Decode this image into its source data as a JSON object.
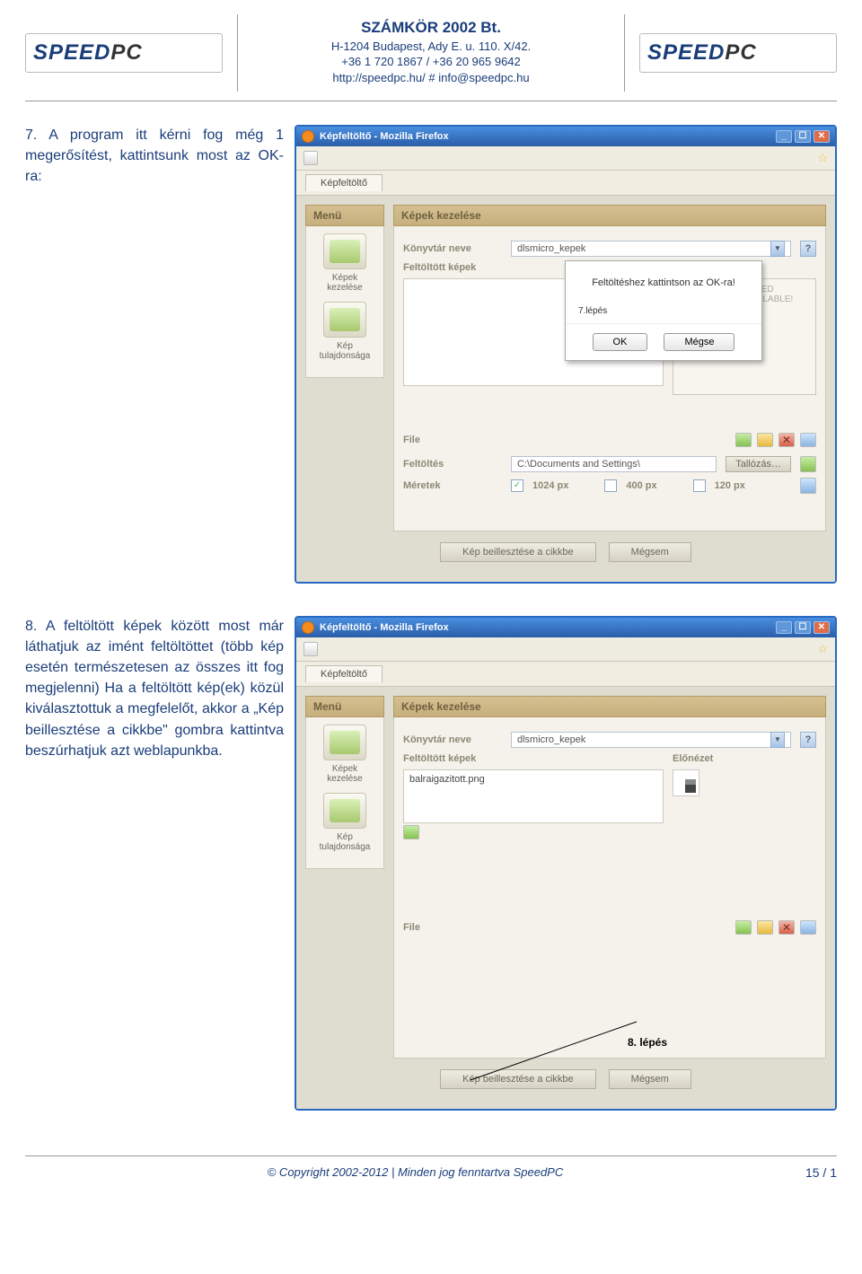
{
  "header": {
    "logo_main": "SPEED",
    "logo_accent": "PC",
    "company": "SZÁMKÖR 2002 Bt.",
    "addr": "H-1204 Budapest, Ady E. u. 110. X/42.",
    "tel": "+36 1 720 1867 / +36 20 965 9642",
    "web": "http://speedpc.hu/ # info@speedpc.hu"
  },
  "step7": {
    "text": "7.   A program itt kérni fog még 1 megerősítést, kattintsunk most az OK-ra:"
  },
  "step8": {
    "text": "8.   A feltöltött képek között most már láthatjuk az imént feltöltöttet (több kép esetén természetesen az összes itt fog megjelenni) Ha a feltöltött kép(ek) közül kiválasztottuk a megfelelőt, akkor a „Kép beillesztése a cikkbe\" gombra kattintva beszúrhatjuk azt weblapunkba."
  },
  "win": {
    "title": "Képfeltöltő - Mozilla Firefox",
    "tab": "Képfeltöltő",
    "side_hdr": "Menü",
    "side_item1": "Képek kezelése",
    "side_item2": "Kép tulajdonsága",
    "main_hdr": "Képek kezelése",
    "lbl_dir": "Könyvtár neve",
    "lbl_uploaded": "Feltöltött képek",
    "lbl_preview": "Előnézet",
    "dir_value": "dlsmicro_kepek",
    "noimg": "NO IMAGE SELECTED PREVIEW NOT AVAILABLE!",
    "lbl_file": "File",
    "lbl_upload": "Feltöltés",
    "lbl_sizes": "Méretek",
    "path": "C:\\Documents and Settings\\",
    "browse": "Tallózás…",
    "s1": "1024 px",
    "s2": "400 px",
    "s3": "120 px",
    "btn_insert": "Kép beillesztése a cikkbe",
    "btn_cancel": "Mégsem",
    "uploaded_file": "balraigazitott.png"
  },
  "dialog": {
    "msg": "Feltöltéshez kattintson az OK-ra!",
    "step": "7.lépés",
    "ok": "OK",
    "cancel": "Mégse"
  },
  "annot8": "8. lépés",
  "footer": {
    "copy": "© Copyright 2002-2012 | Minden jog fenntartva SpeedPC",
    "page": "15 / 1"
  }
}
